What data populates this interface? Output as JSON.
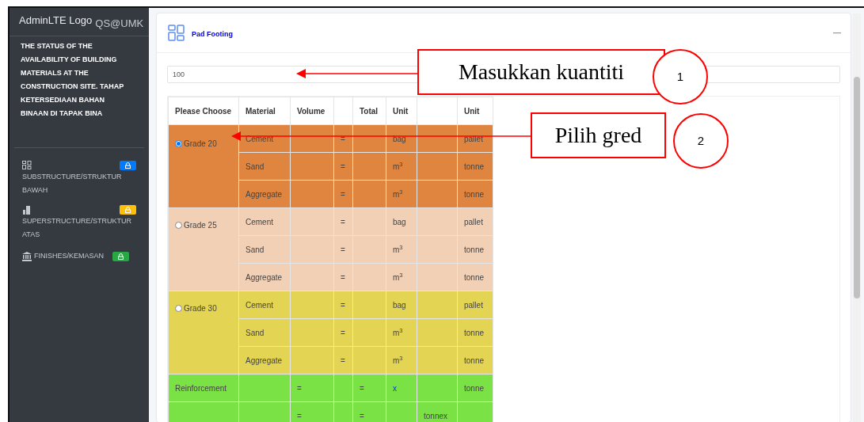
{
  "sidebar": {
    "brand": "AdminLTE Logo",
    "brand_text": "QS@UMK",
    "description": "THE STATUS OF THE AVAILABILITY OF BUILDING MATERIALS AT THE CONSTRUCTION SITE. TAHAP KETERSEDIAAN BAHAN BINAAN DI TAPAK BINA",
    "items": [
      {
        "kind": "grid",
        "label": "SUBSTRUCTURE/STRUKTUR BAWAH",
        "color": "#007bff"
      },
      {
        "kind": "building",
        "label": "SUPERSTRUCTURE/STRUKTUR ATAS",
        "color": "#ffc107"
      },
      {
        "kind": "bank",
        "label": "FINISHES/KEMASAN",
        "color": "#28a745"
      }
    ]
  },
  "card": {
    "title": "Pad Footing",
    "quantity": "100",
    "columns": [
      {
        "label": "Please Choose"
      },
      {
        "label": "Material"
      },
      {
        "label": "Volume"
      },
      {},
      {
        "label": "Total"
      },
      {
        "label": "Unit"
      },
      {},
      {
        "label": "Unit"
      }
    ],
    "grades": [
      {
        "label": "Grade 20",
        "selected": true,
        "color": "#e0853f",
        "rows": [
          [
            {
              "text": "Cement"
            },
            {},
            {
              "text": "="
            },
            {},
            {
              "text": "bag"
            },
            {},
            {
              "text": "pallet"
            }
          ],
          [
            {
              "text": "Sand"
            },
            {},
            {
              "text": "="
            },
            {},
            {
              "text": "m$^{3}$"
            },
            {},
            {
              "text": "tonne"
            }
          ],
          [
            {
              "text": "Aggregate"
            },
            {},
            {
              "text": "="
            },
            {},
            {
              "text": "m$^{3}$"
            },
            {},
            {
              "text": "tonne"
            }
          ]
        ]
      },
      {
        "label": "Grade 25",
        "selected": false,
        "color": "#f2d0b5",
        "rows": [
          [
            {
              "text": "Cement"
            },
            {},
            {
              "text": "="
            },
            {},
            {
              "text": "bag"
            },
            {},
            {
              "text": "pallet"
            }
          ],
          [
            {
              "text": "Sand"
            },
            {},
            {
              "text": "="
            },
            {},
            {
              "text": "m$^{3}$"
            },
            {},
            {
              "text": "tonne"
            }
          ],
          [
            {
              "text": "Aggregate"
            },
            {},
            {
              "text": "="
            },
            {},
            {
              "text": "m$^{3}$"
            },
            {},
            {
              "text": "tonne"
            }
          ]
        ]
      },
      {
        "label": "Grade 30",
        "selected": false,
        "color": "#e3d454",
        "rows": [
          [
            {
              "text": "Cement"
            },
            {},
            {
              "text": "="
            },
            {},
            {
              "text": "bag"
            },
            {},
            {
              "text": "pallet"
            }
          ],
          [
            {
              "text": "Sand"
            },
            {},
            {
              "text": "="
            },
            {},
            {
              "text": "m$^{3}$"
            },
            {},
            {
              "text": "tonne"
            }
          ],
          [
            {
              "text": "Aggregate"
            },
            {},
            {
              "text": "="
            },
            {},
            {
              "text": "m$^{3}$"
            },
            {},
            {
              "text": "tonne"
            }
          ]
        ]
      }
    ],
    "reinforcement": {
      "color": "#7be245",
      "rows": [
        [
          {
            "text": "Reinforcement"
          },
          {},
          {
            "text": "="
          },
          {},
          {
            "text": "="
          },
          {
            "text": "x",
            "kind": "link"
          },
          {},
          {
            "text": "tonne"
          }
        ],
        [
          {},
          {},
          {
            "text": "="
          },
          {},
          {
            "text": "="
          },
          {},
          {
            "text": "tonnex"
          },
          {}
        ]
      ]
    }
  },
  "annotations": [
    {
      "text": "Masukkan kuantiti",
      "number": "1"
    },
    {
      "text": "Pilih gred",
      "number": "2"
    }
  ]
}
